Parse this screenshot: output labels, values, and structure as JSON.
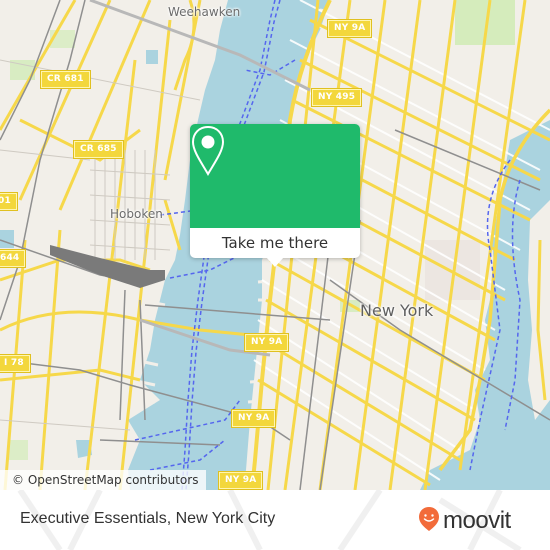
{
  "map": {
    "place_labels": [
      {
        "id": "weehawken",
        "text": "Weehawken"
      },
      {
        "id": "hoboken",
        "text": "Hoboken"
      },
      {
        "id": "new-york",
        "text": "New York"
      }
    ],
    "road_shields": [
      {
        "id": "cr-681",
        "text": "CR 681"
      },
      {
        "id": "cr-685",
        "text": "CR 685"
      },
      {
        "id": "ny-9a-top",
        "text": "NY 9A"
      },
      {
        "id": "ny-495",
        "text": "NY 495"
      },
      {
        "id": "cr-501-partial",
        "text": "01"
      },
      {
        "id": "cr-644-partial",
        "text": "644"
      },
      {
        "id": "i-78",
        "text": "I 78"
      },
      {
        "id": "ny-9a-mid",
        "text": "NY 9A"
      },
      {
        "id": "ny-9a-lower",
        "text": "NY 9A"
      },
      {
        "id": "ny-9a-bottom",
        "text": "NY 9A"
      }
    ],
    "attribution": "© OpenStreetMap contributors"
  },
  "popup": {
    "icon": "location-pin-icon",
    "button_label": "Take me there",
    "accent_color": "#1fba6b"
  },
  "footer": {
    "title": "Executive Essentials, New York City",
    "brand": "moovit",
    "brand_color": "#f26b3a"
  }
}
